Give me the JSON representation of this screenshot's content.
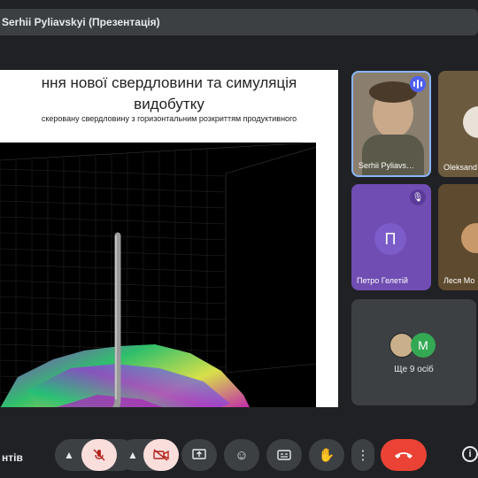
{
  "presentation_bar": {
    "text": "Serhii Pyliavskyi (Презентація)"
  },
  "slide": {
    "title_line1": "ння нової свердловини та симуляція",
    "title_line2": "видобутку",
    "subtitle": "скеровану свердловину з горизонтальним розкриттям продуктивного"
  },
  "participants": [
    {
      "name": "Serhii Pyliavs…"
    },
    {
      "name": "Oleksand"
    },
    {
      "name": "Петро Гелетій",
      "initial": "П"
    },
    {
      "name": "Леся Мо"
    }
  ],
  "more_participants": {
    "label": "Ще 9 осіб",
    "avatar_initial": "M"
  },
  "bottom": {
    "left_label": "нтів"
  },
  "colors": {
    "hangup": "#ea4335",
    "muted_bg": "#f9dedc",
    "active_border": "#8ab4f8"
  }
}
